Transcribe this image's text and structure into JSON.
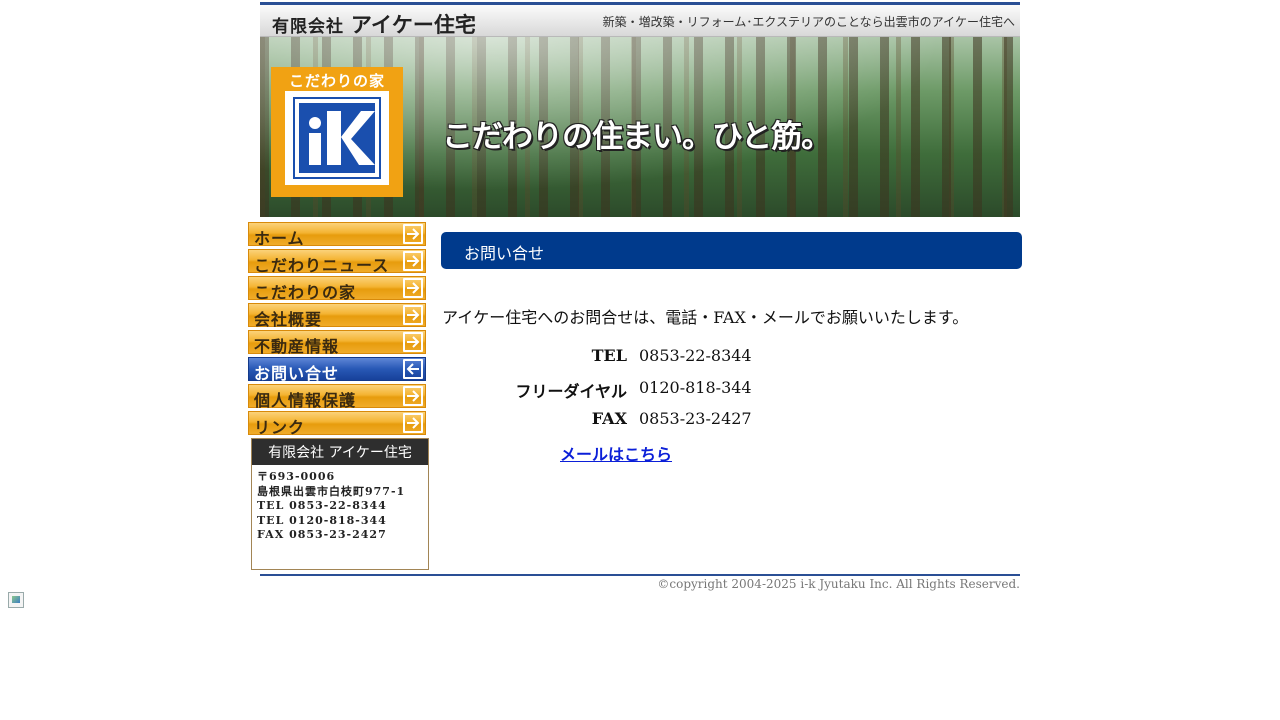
{
  "header": {
    "company_prefix": "有限会社",
    "company_name": "アイケー住宅",
    "tagline": "新築・増改築・リフォーム･エクステリアのことなら出雲市のアイケー住宅へ"
  },
  "hero": {
    "badge_label": "こだわりの家",
    "badge_logo_letter": "iK",
    "catchcopy": "こだわりの住まい。ひと筋。"
  },
  "nav": {
    "items": [
      {
        "label": "ホーム",
        "active": false
      },
      {
        "label": "こだわりニュース",
        "active": false
      },
      {
        "label": "こだわりの家",
        "active": false
      },
      {
        "label": "会社概要",
        "active": false
      },
      {
        "label": "不動産情報",
        "active": false
      },
      {
        "label": "お問い合せ",
        "active": true
      },
      {
        "label": "個人情報保護",
        "active": false
      },
      {
        "label": "リンク",
        "active": false
      }
    ]
  },
  "company_box": {
    "title": "有限会社 アイケー住宅",
    "lines": [
      "〒693-0006",
      "島根県出雲市白枝町977-1",
      "TEL 0853-22-8344",
      "TEL 0120-818-344",
      "FAX 0853-23-2427"
    ]
  },
  "main": {
    "page_title": "お問い合せ",
    "intro": "アイケー住宅へのお問合せは、電話・FAX・メールでお願いいたします。",
    "contacts": [
      {
        "label": "TEL",
        "value": "0853-22-8344"
      },
      {
        "label": "フリーダイヤル",
        "value": "0120-818-344"
      },
      {
        "label": "FAX",
        "value": "0853-23-2427"
      }
    ],
    "mail_link": "メールはこちら"
  },
  "footer": {
    "copyright": "©copyright 2004-2025 i-k Jyutaku Inc. All Rights Reserved."
  },
  "colors": {
    "brand_blue": "#003a8c",
    "nav_orange": "#f4b331",
    "badge_orange": "#f1a213",
    "link_blue": "#0b1fd8"
  }
}
